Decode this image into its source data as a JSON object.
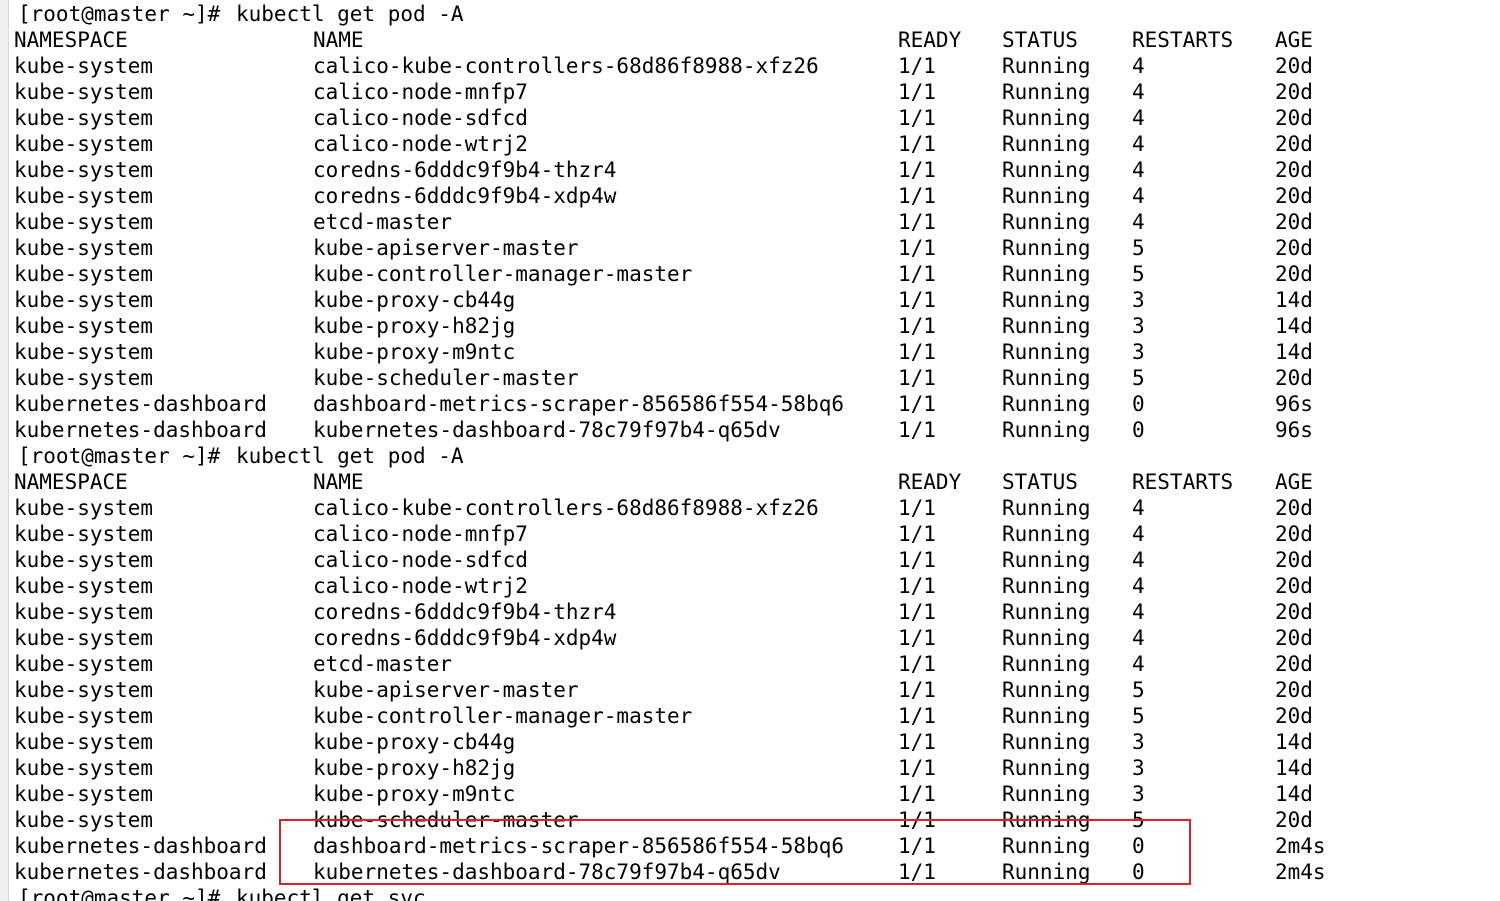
{
  "colors": {
    "background": "#ffffff",
    "text": "#000000",
    "highlight_box": "#e0202a"
  },
  "terminal": {
    "prompt": "[root@master ~]#",
    "command1": "kubectl get pod -A",
    "headers": [
      "NAMESPACE",
      "NAME",
      "READY",
      "STATUS",
      "RESTARTS",
      "AGE"
    ],
    "output1": [
      [
        "kube-system",
        "calico-kube-controllers-68d86f8988-xfz26",
        "1/1",
        "Running",
        "4",
        "20d"
      ],
      [
        "kube-system",
        "calico-node-mnfp7",
        "1/1",
        "Running",
        "4",
        "20d"
      ],
      [
        "kube-system",
        "calico-node-sdfcd",
        "1/1",
        "Running",
        "4",
        "20d"
      ],
      [
        "kube-system",
        "calico-node-wtrj2",
        "1/1",
        "Running",
        "4",
        "20d"
      ],
      [
        "kube-system",
        "coredns-6dddc9f9b4-thzr4",
        "1/1",
        "Running",
        "4",
        "20d"
      ],
      [
        "kube-system",
        "coredns-6dddc9f9b4-xdp4w",
        "1/1",
        "Running",
        "4",
        "20d"
      ],
      [
        "kube-system",
        "etcd-master",
        "1/1",
        "Running",
        "4",
        "20d"
      ],
      [
        "kube-system",
        "kube-apiserver-master",
        "1/1",
        "Running",
        "5",
        "20d"
      ],
      [
        "kube-system",
        "kube-controller-manager-master",
        "1/1",
        "Running",
        "5",
        "20d"
      ],
      [
        "kube-system",
        "kube-proxy-cb44g",
        "1/1",
        "Running",
        "3",
        "14d"
      ],
      [
        "kube-system",
        "kube-proxy-h82jg",
        "1/1",
        "Running",
        "3",
        "14d"
      ],
      [
        "kube-system",
        "kube-proxy-m9ntc",
        "1/1",
        "Running",
        "3",
        "14d"
      ],
      [
        "kube-system",
        "kube-scheduler-master",
        "1/1",
        "Running",
        "5",
        "20d"
      ],
      [
        "kubernetes-dashboard",
        "dashboard-metrics-scraper-856586f554-58bq6",
        "1/1",
        "Running",
        "0",
        "96s"
      ],
      [
        "kubernetes-dashboard",
        "kubernetes-dashboard-78c79f97b4-q65dv",
        "1/1",
        "Running",
        "0",
        "96s"
      ]
    ],
    "command2": "kubectl get pod -A",
    "output2": [
      [
        "kube-system",
        "calico-kube-controllers-68d86f8988-xfz26",
        "1/1",
        "Running",
        "4",
        "20d"
      ],
      [
        "kube-system",
        "calico-node-mnfp7",
        "1/1",
        "Running",
        "4",
        "20d"
      ],
      [
        "kube-system",
        "calico-node-sdfcd",
        "1/1",
        "Running",
        "4",
        "20d"
      ],
      [
        "kube-system",
        "calico-node-wtrj2",
        "1/1",
        "Running",
        "4",
        "20d"
      ],
      [
        "kube-system",
        "coredns-6dddc9f9b4-thzr4",
        "1/1",
        "Running",
        "4",
        "20d"
      ],
      [
        "kube-system",
        "coredns-6dddc9f9b4-xdp4w",
        "1/1",
        "Running",
        "4",
        "20d"
      ],
      [
        "kube-system",
        "etcd-master",
        "1/1",
        "Running",
        "4",
        "20d"
      ],
      [
        "kube-system",
        "kube-apiserver-master",
        "1/1",
        "Running",
        "5",
        "20d"
      ],
      [
        "kube-system",
        "kube-controller-manager-master",
        "1/1",
        "Running",
        "5",
        "20d"
      ],
      [
        "kube-system",
        "kube-proxy-cb44g",
        "1/1",
        "Running",
        "3",
        "14d"
      ],
      [
        "kube-system",
        "kube-proxy-h82jg",
        "1/1",
        "Running",
        "3",
        "14d"
      ],
      [
        "kube-system",
        "kube-proxy-m9ntc",
        "1/1",
        "Running",
        "3",
        "14d"
      ],
      [
        "kube-system",
        "kube-scheduler-master",
        "1/1",
        "Running",
        "5",
        "20d"
      ],
      [
        "kubernetes-dashboard",
        "dashboard-metrics-scraper-856586f554-58bq6",
        "1/1",
        "Running",
        "0",
        "2m4s"
      ],
      [
        "kubernetes-dashboard",
        "kubernetes-dashboard-78c79f97b4-q65dv",
        "1/1",
        "Running",
        "0",
        "2m4s"
      ]
    ],
    "command3": "kubectl get svc"
  }
}
